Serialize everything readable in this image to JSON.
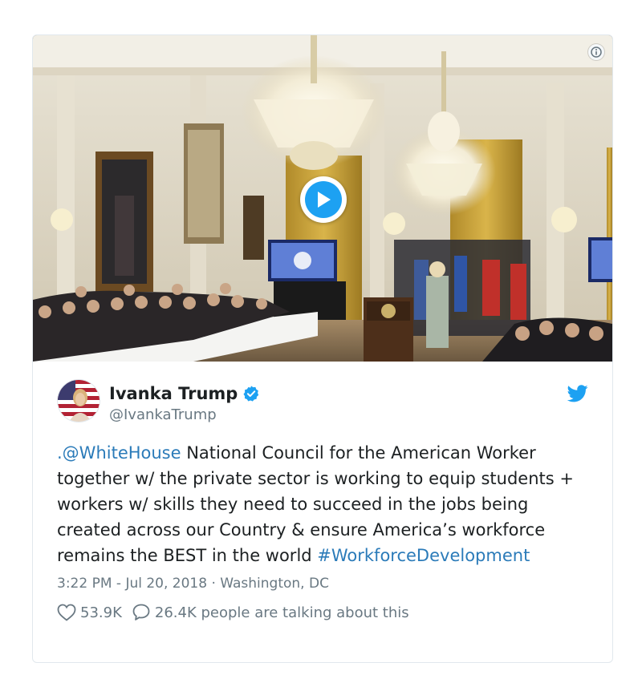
{
  "media": {
    "icon_info": "info-circle-icon",
    "icon_play": "play-icon"
  },
  "author": {
    "name": "Ivanka Trump",
    "handle": "@IvankaTrump",
    "verified_icon": "verified-badge-icon",
    "avatar_icon": "avatar-image"
  },
  "brand": {
    "icon": "twitter-bird-icon",
    "color": "#1da1f2"
  },
  "tweet": {
    "mention": ".@WhiteHouse",
    "text_main": " National Council for the American Worker together w/ the private sector is working to equip students + workers w/ skills they need to succeed in the jobs being created across our Country & ensure America’s workforce remains the BEST in the world ",
    "hashtag": "#WorkforceDevelopment",
    "link_color": "#2b7bb9"
  },
  "meta": {
    "timestamp": "3:22 PM - Jul 20, 2018",
    "separator": " · ",
    "location": "Washington, DC"
  },
  "actions": {
    "likes_icon": "heart-icon",
    "likes": "53.9K",
    "comments_icon": "speech-bubble-icon",
    "talking_text": "26.4K people are talking about this"
  }
}
